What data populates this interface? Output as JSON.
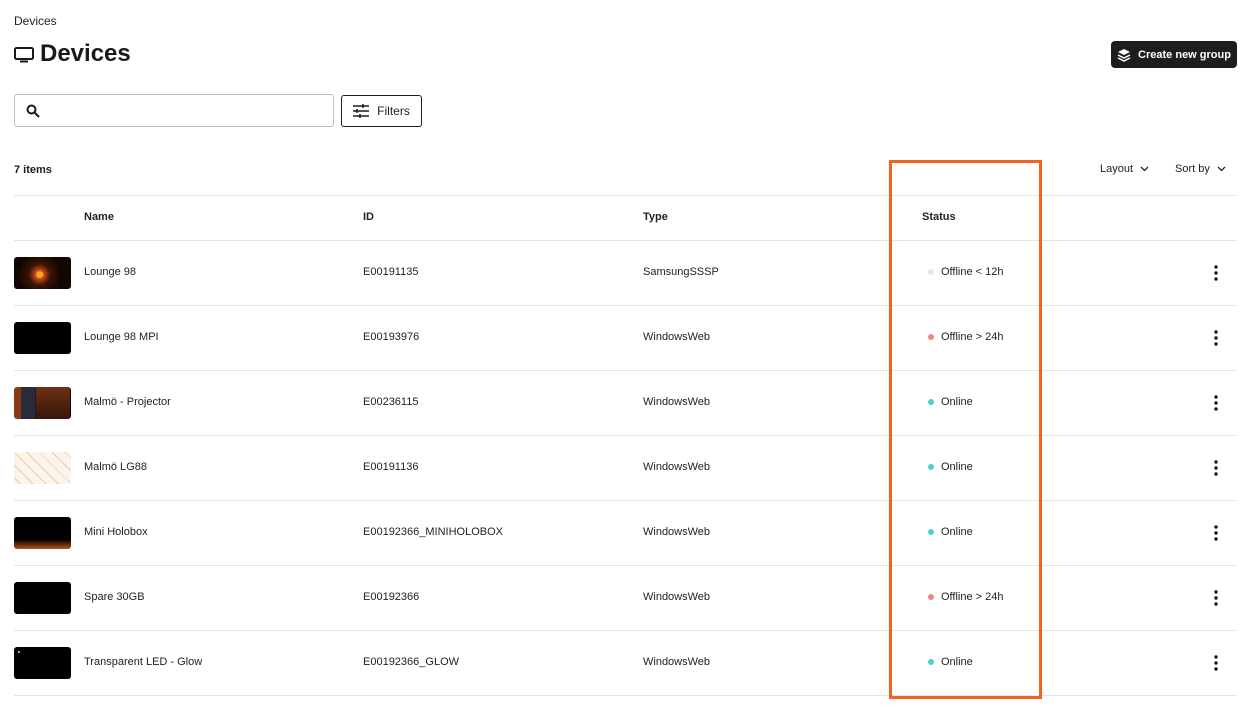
{
  "breadcrumb": "Devices",
  "page_title": "Devices",
  "create_button": "Create new group",
  "search": {
    "placeholder": "",
    "value": ""
  },
  "filters_label": "Filters",
  "item_count": "7 items",
  "layout_label": "Layout",
  "sort_label": "Sort by",
  "columns": {
    "name": "Name",
    "id": "ID",
    "type": "Type",
    "status": "Status"
  },
  "colors": {
    "online": "#4fd1cb",
    "offline_long": "#e88a8a",
    "offline_short": "#f2e4e4",
    "highlight": "#f0641e"
  },
  "rows": [
    {
      "name": "Lounge 98",
      "id": "E00191135",
      "type": "SamsungSSSP",
      "status": "Offline < 12h",
      "status_kind": "offline_short",
      "thumb": "fire"
    },
    {
      "name": "Lounge 98 MPI",
      "id": "E00193976",
      "type": "WindowsWeb",
      "status": "Offline > 24h",
      "status_kind": "offline_long",
      "thumb": "black"
    },
    {
      "name": "Malmö - Projector",
      "id": "E00236115",
      "type": "WindowsWeb",
      "status": "Online",
      "status_kind": "online",
      "thumb": "proj"
    },
    {
      "name": "Malmö LG88",
      "id": "E00191136",
      "type": "WindowsWeb",
      "status": "Online",
      "status_kind": "online",
      "thumb": "sketch"
    },
    {
      "name": "Mini Holobox",
      "id": "E00192366_MINIHOLOBOX",
      "type": "WindowsWeb",
      "status": "Online",
      "status_kind": "online",
      "thumb": "holo"
    },
    {
      "name": "Spare 30GB",
      "id": "E00192366",
      "type": "WindowsWeb",
      "status": "Offline > 24h",
      "status_kind": "offline_long",
      "thumb": "black"
    },
    {
      "name": "Transparent LED - Glow",
      "id": "E00192366_GLOW",
      "type": "WindowsWeb",
      "status": "Online",
      "status_kind": "online",
      "thumb": "glow"
    }
  ]
}
